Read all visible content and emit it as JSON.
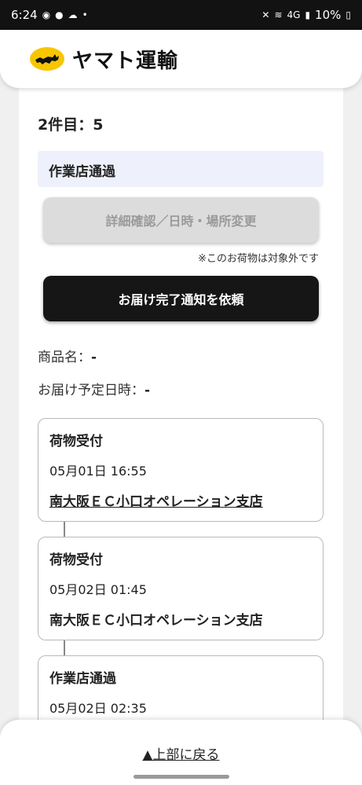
{
  "status_bar": {
    "time": "6:24",
    "battery": "10%",
    "network": "4G"
  },
  "header": {
    "brand": "ヤマト運輸",
    "logo_color": "#f7c600"
  },
  "item": {
    "title": "2件目：5",
    "status": "作業店通過"
  },
  "buttons": {
    "detail": "詳細確認／日時・場所変更",
    "note": "※このお荷物は対象外です",
    "notify": "お届け完了通知を依頼"
  },
  "info": {
    "product_label": "商品名：",
    "product_value": "-",
    "delivery_label": "お届け予定日時：",
    "delivery_value": "-"
  },
  "timeline": [
    {
      "status": "荷物受付",
      "time": "05月01日 16:55",
      "place": "南大阪ＥＣ小口オペレーション支店"
    },
    {
      "status": "荷物受付",
      "time": "05月02日 01:45",
      "place": "南大阪ＥＣ小口オペレーション支店"
    },
    {
      "status": "作業店通過",
      "time": "05月02日 02:35",
      "place": ""
    }
  ],
  "footer": {
    "back_to_top": "▲上部に戻る"
  }
}
